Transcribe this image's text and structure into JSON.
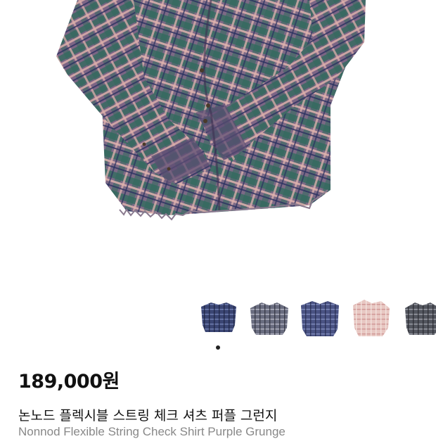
{
  "product": {
    "price": "189,000원",
    "title_ko": "논노드 플렉시블 스트링 체크 셔츠 퍼플 그런지",
    "title_en": "Nonnod Flexible String Check Shirt Purple Grunge"
  },
  "gallery": {
    "main_image": "plaid-shirt-purple-green",
    "thumbnails": [
      {
        "name": "thumb-navy-plaid",
        "base": "#3b4674",
        "line": "#1c2240",
        "accent": "#8b9bd0"
      },
      {
        "name": "thumb-grey-plaid",
        "base": "#6a6d80",
        "line": "#2d2e3b",
        "accent": "#c9c9d4"
      },
      {
        "name": "thumb-blue-plaid",
        "base": "#4a5384",
        "line": "#262b4e",
        "accent": "#9aa6d6"
      },
      {
        "name": "thumb-pink-plaid",
        "base": "#e8c7c2",
        "line": "#c98a8a",
        "accent": "#f4e6e2"
      },
      {
        "name": "thumb-charcoal-plaid",
        "base": "#53565f",
        "line": "#25272d",
        "accent": "#b0b3bb"
      }
    ],
    "active_index": 0
  },
  "colors": {
    "shirt_base": "#8a6f88",
    "shirt_green": "#2f6a5c",
    "shirt_navy": "#2a3160",
    "shirt_pink": "#d9a9a6"
  }
}
